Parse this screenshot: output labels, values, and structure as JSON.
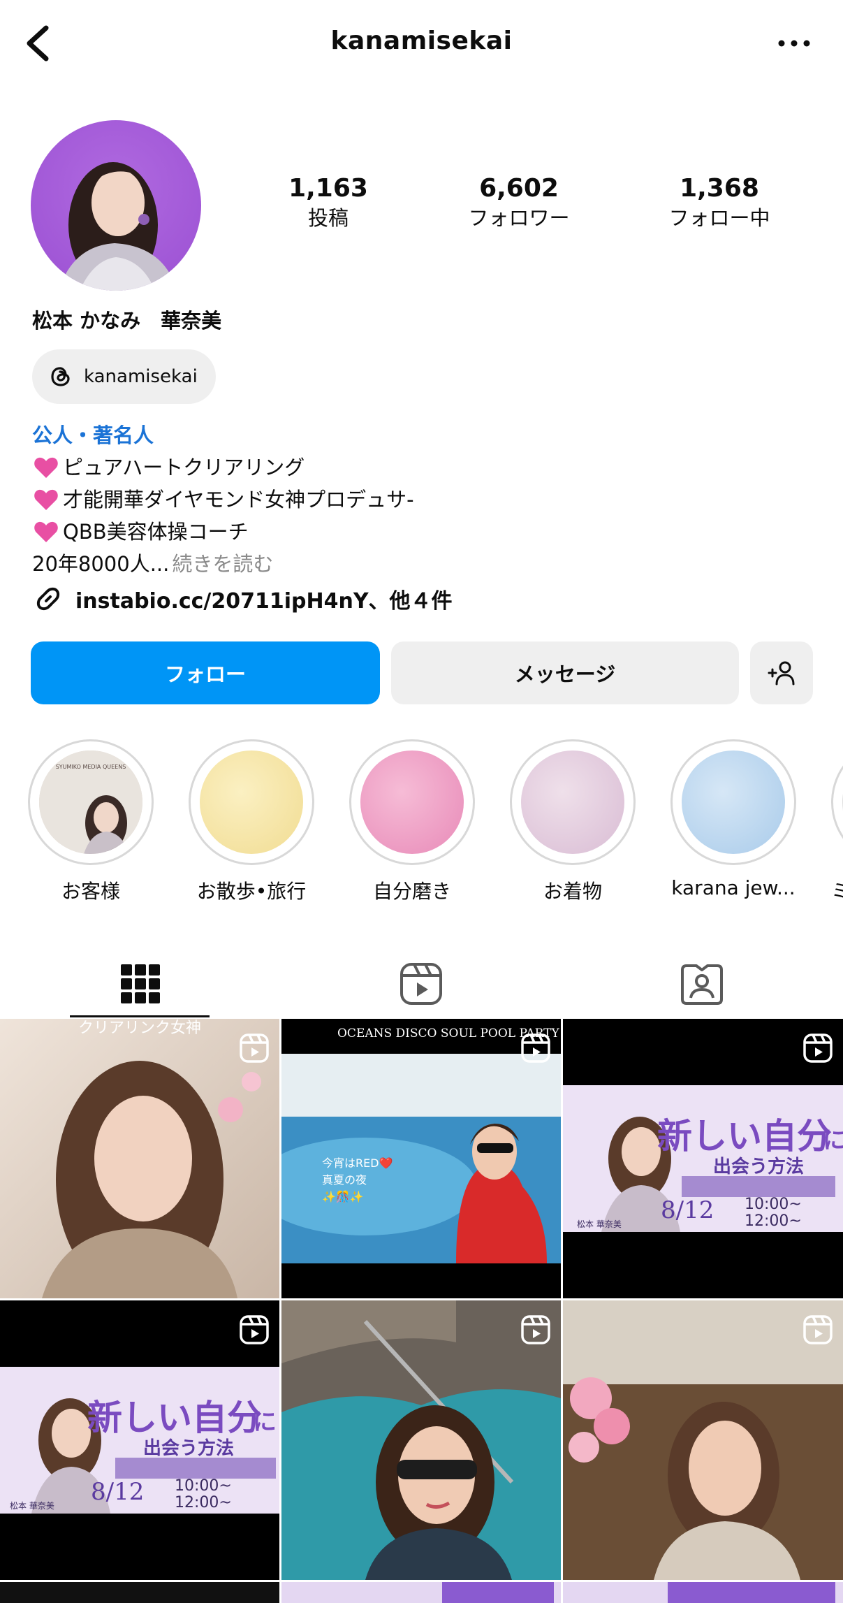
{
  "header": {
    "title": "kanamisekai"
  },
  "stats": [
    {
      "value": "1,163",
      "label": "投稿"
    },
    {
      "value": "6,602",
      "label": "フォロワー"
    },
    {
      "value": "1,368",
      "label": "フォロー中"
    }
  ],
  "profile": {
    "name": "松本 かなみ　華奈美",
    "threads_handle": "kanamisekai",
    "category": "公人・著名人",
    "bio_lines": [
      "ピュアハートクリアリング",
      "才能開華ダイヤモンド女神プロデュサ-",
      "QBB美容体操コーチ"
    ],
    "bio_last": "20年8000人...",
    "read_more": "続きを読む",
    "link": "instabio.cc/20711ipH4nY、他４件"
  },
  "buttons": {
    "follow": "フォロー",
    "message": "メッセージ"
  },
  "highlights": [
    {
      "label": "お客様",
      "color": "#d9cfc4",
      "cover_text": "SYUMIKO MEDIA QUEENS"
    },
    {
      "label": "お散歩•旅行",
      "color": "#f5e6a8"
    },
    {
      "label": "自分磨き",
      "color": "#f0a6c8"
    },
    {
      "label": "お着物",
      "color": "#e3cde0"
    },
    {
      "label": "karana jew...",
      "color": "#bcd7ef"
    },
    {
      "label": "ミ",
      "color": "#e0e0e0"
    }
  ],
  "posts": {
    "p1_caption": "クリアリンク女神",
    "p2_caption": "OCEANS DISCO SOUL POOL PARTY",
    "p2_overlay_1": "今宵はRED❤️",
    "p2_overlay_2": "真夏の夜",
    "p2_overlay_3": "✨🎊✨",
    "banner_title_a": "新しい自分",
    "banner_title_b": "に",
    "banner_sub": "出会う方法",
    "banner_name": "松本 華奈美",
    "banner_date": "8/12",
    "banner_time_1": "10:00~",
    "banner_time_2": "12:00~"
  }
}
